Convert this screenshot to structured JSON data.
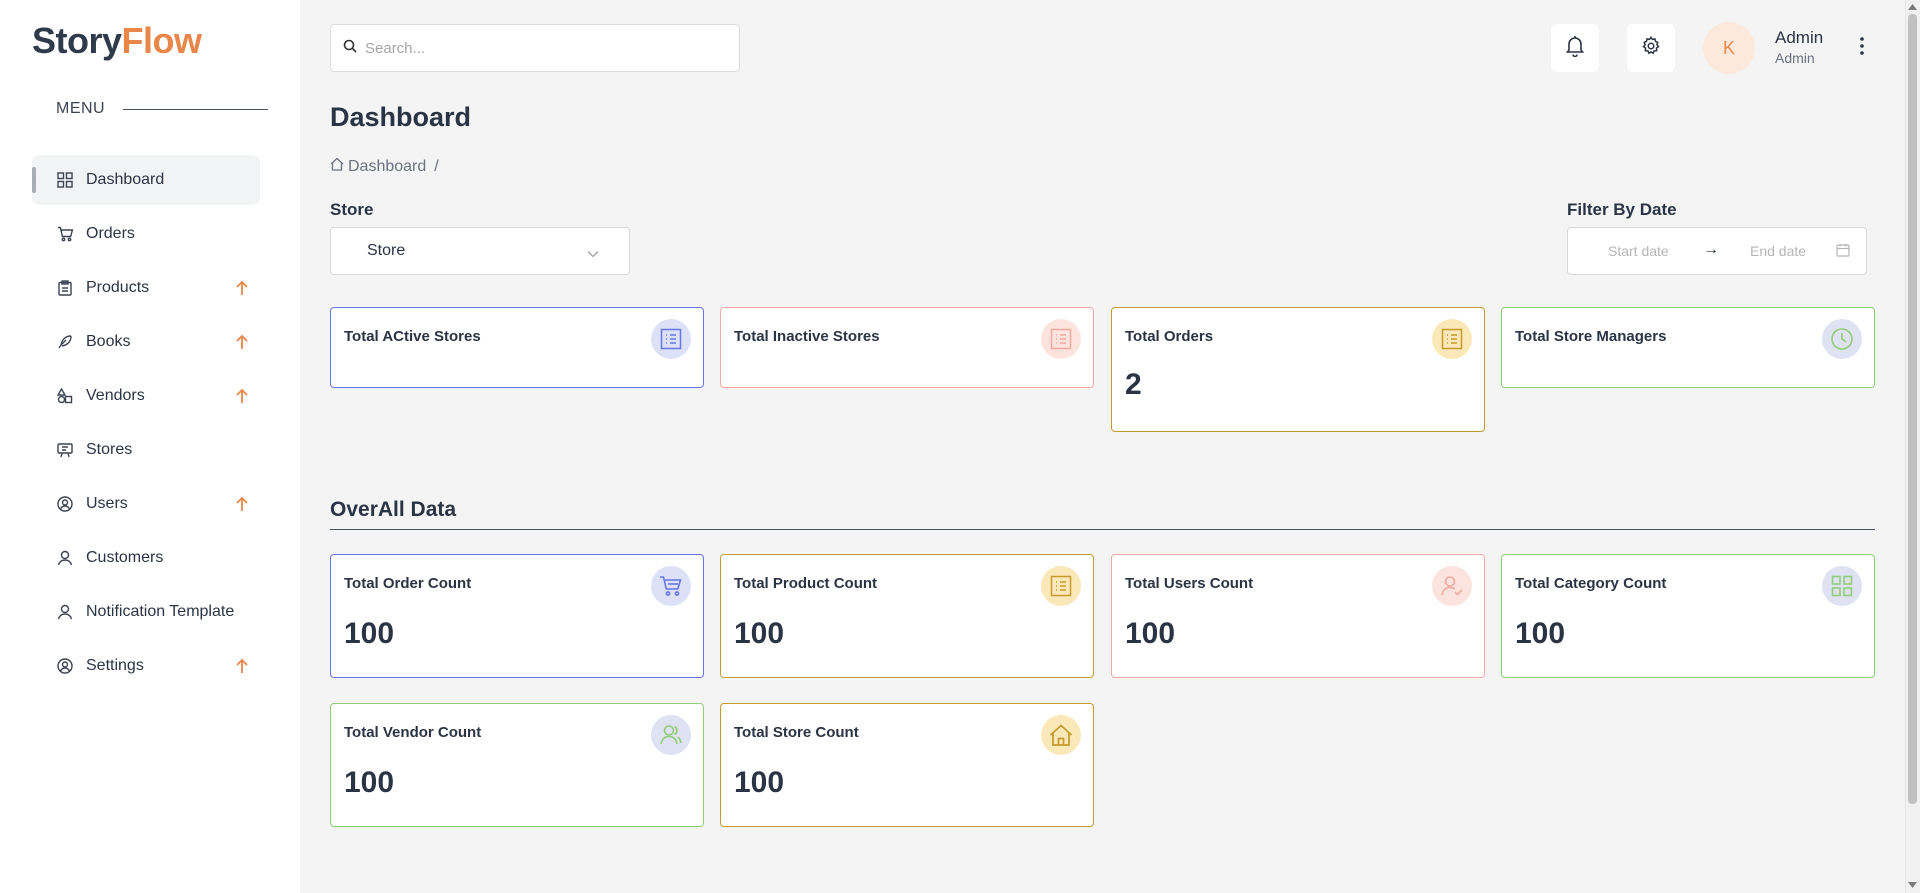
{
  "brand": {
    "part1": "Story",
    "part2": "Flow",
    "color": "#e9874a"
  },
  "sidebar": {
    "menu_label": "MENU",
    "items": [
      {
        "label": "Dashboard",
        "icon": "dashboard-grid-icon",
        "active": true,
        "expandable": false
      },
      {
        "label": "Orders",
        "icon": "cart-icon",
        "expandable": false
      },
      {
        "label": "Products",
        "icon": "clipboard-icon",
        "expandable": true
      },
      {
        "label": "Books",
        "icon": "feather-icon",
        "expandable": true
      },
      {
        "label": "Vendors",
        "icon": "shapes-icon",
        "expandable": true
      },
      {
        "label": "Stores",
        "icon": "storefront-icon",
        "expandable": false
      },
      {
        "label": "Users",
        "icon": "user-circle-icon",
        "expandable": true
      },
      {
        "label": "Customers",
        "icon": "user-icon",
        "expandable": false
      },
      {
        "label": "Notification Template",
        "icon": "user-icon",
        "expandable": false
      },
      {
        "label": "Settings",
        "icon": "settings-user-icon",
        "expandable": true
      }
    ]
  },
  "header": {
    "search_placeholder": "Search...",
    "user_initial": "K",
    "user_name": "Admin",
    "user_role": "Admin"
  },
  "page": {
    "title": "Dashboard",
    "breadcrumb": {
      "item": "Dashboard",
      "separator": "/"
    }
  },
  "filters": {
    "store_label": "Store",
    "store_value": "Store",
    "date_label": "Filter By Date",
    "start_placeholder": "Start date",
    "end_placeholder": "End date",
    "arrow": "→"
  },
  "summary_cards": [
    {
      "title": "Total ACtive Stores",
      "value": "",
      "icon": "list-icon"
    },
    {
      "title": "Total Inactive Stores",
      "value": "",
      "icon": "list-icon"
    },
    {
      "title": "Total Orders",
      "value": "2",
      "icon": "list-icon"
    },
    {
      "title": "Total Store Managers",
      "value": "",
      "icon": "clock-icon"
    }
  ],
  "overall": {
    "title": "OverAll Data",
    "cards": [
      {
        "title": "Total Order Count",
        "value": "100",
        "icon": "cart-icon"
      },
      {
        "title": "Total Product Count",
        "value": "100",
        "icon": "list-icon"
      },
      {
        "title": "Total Users Count",
        "value": "100",
        "icon": "user-icon"
      },
      {
        "title": "Total Category Count",
        "value": "100",
        "icon": "grid-icon"
      },
      {
        "title": "Total Vendor Count",
        "value": "100",
        "icon": "users-icon"
      },
      {
        "title": "Total Store Count",
        "value": "100",
        "icon": "home-icon"
      }
    ]
  },
  "colors": {
    "blue": "#6677e6",
    "pink": "#f1aaa0",
    "gold": "#c69a2c",
    "green": "#8fcd78",
    "accent": "#e9874a"
  }
}
